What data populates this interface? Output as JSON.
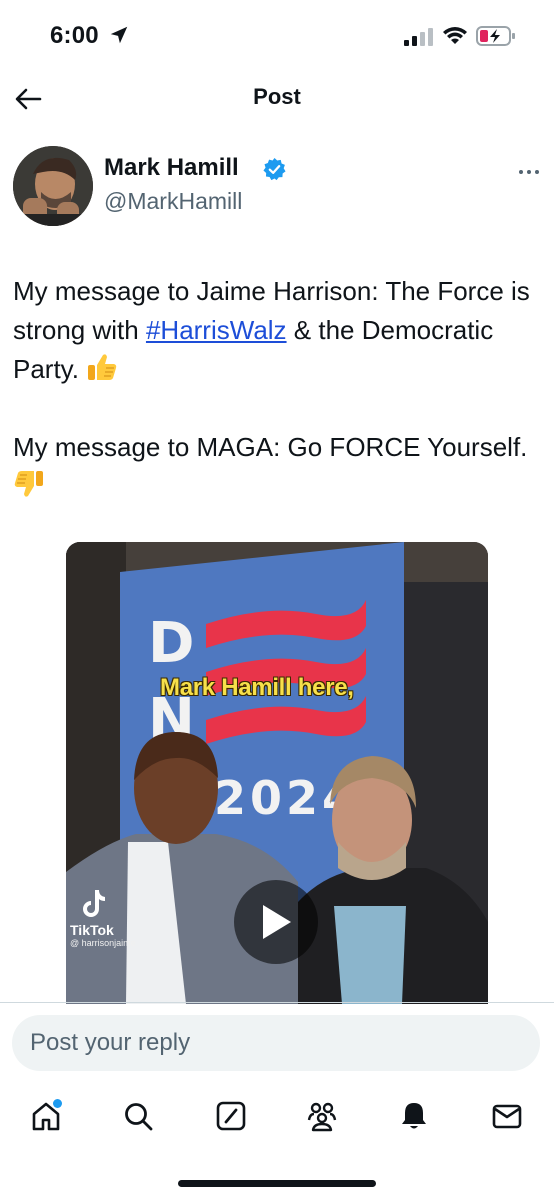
{
  "status_bar": {
    "time": "6:00",
    "icons": [
      "location-arrow-icon",
      "cellular-signal-icon",
      "wifi-icon",
      "battery-charging-icon"
    ],
    "battery_color": "#e0245e"
  },
  "header": {
    "title": "Post",
    "back_icon": "back-arrow-icon"
  },
  "author": {
    "name": "Mark Hamill",
    "handle": "@MarkHamill",
    "verified": true,
    "verified_color": "#1d9bf0",
    "more_icon": "more-options-icon"
  },
  "tweet": {
    "line1_before": "My message to Jaime Harrison: The Force is strong with ",
    "hashtag": "#HarrisWalz",
    "line1_after": " & the Democratic Party. ",
    "emoji1": "thumbs-up-icon",
    "line2": "My message to MAGA: Go FORCE Yourself. ",
    "emoji2": "thumbs-down-icon"
  },
  "media": {
    "caption": "Mark Hamill here,",
    "sign_text": "2024",
    "sign_letters": "DN",
    "tiktok_label": "TikTok",
    "tiktok_handle": "@ harrisonjaime",
    "play_icon": "play-icon"
  },
  "reply": {
    "placeholder": "Post your reply"
  },
  "nav": {
    "items": [
      "home-icon",
      "search-icon",
      "grok-icon",
      "communities-icon",
      "notifications-icon",
      "messages-icon"
    ],
    "accent": "#1d9bf0"
  }
}
